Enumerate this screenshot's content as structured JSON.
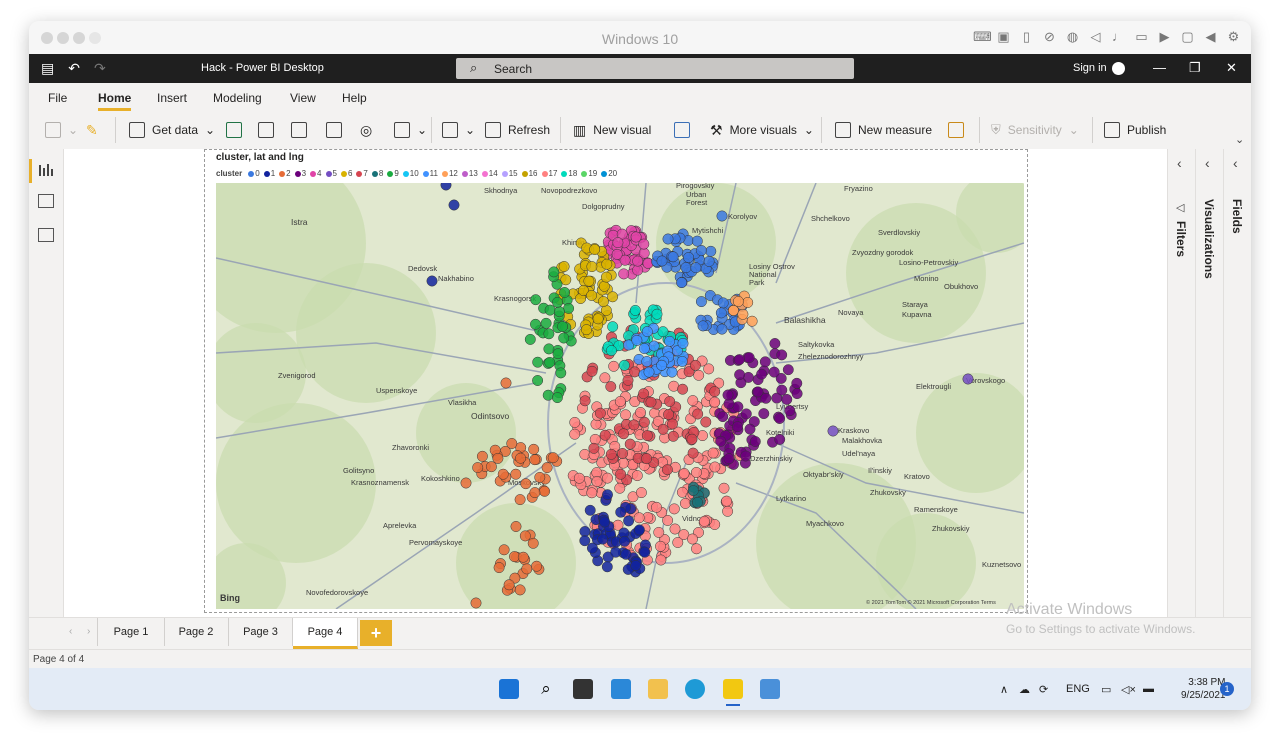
{
  "vm": {
    "title": "Windows 10"
  },
  "app": {
    "title": "Hack - Power BI Desktop",
    "search_placeholder": "Search",
    "sign_in": "Sign in"
  },
  "menu": [
    "File",
    "Home",
    "Insert",
    "Modeling",
    "View",
    "Help"
  ],
  "ribbon": {
    "get_data": "Get data",
    "refresh": "Refresh",
    "new_visual": "New visual",
    "more_visuals": "More visuals",
    "new_measure": "New measure",
    "sensitivity": "Sensitivity",
    "publish": "Publish"
  },
  "visual": {
    "title": "cluster, lat and lng",
    "legend_title": "cluster",
    "legend": [
      {
        "label": "0",
        "color": "#3b79e0"
      },
      {
        "label": "1",
        "color": "#12239e"
      },
      {
        "label": "2",
        "color": "#e66c37"
      },
      {
        "label": "3",
        "color": "#6b007b"
      },
      {
        "label": "4",
        "color": "#e044a7"
      },
      {
        "label": "5",
        "color": "#744ec2"
      },
      {
        "label": "6",
        "color": "#d9b300"
      },
      {
        "label": "7",
        "color": "#d64550"
      },
      {
        "label": "8",
        "color": "#197278"
      },
      {
        "label": "9",
        "color": "#1aab40"
      },
      {
        "label": "10",
        "color": "#15c6f4"
      },
      {
        "label": "11",
        "color": "#4092ff"
      },
      {
        "label": "12",
        "color": "#ffa058"
      },
      {
        "label": "13",
        "color": "#be5dc9"
      },
      {
        "label": "14",
        "color": "#f472d0"
      },
      {
        "label": "15",
        "color": "#b5a1ff"
      },
      {
        "label": "16",
        "color": "#c4a200"
      },
      {
        "label": "17",
        "color": "#ff8080"
      },
      {
        "label": "18",
        "color": "#00dbbc"
      },
      {
        "label": "19",
        "color": "#5bd667"
      },
      {
        "label": "20",
        "color": "#0091d5"
      }
    ],
    "map_places": [
      "Skhodnya",
      "Novopodrezkovo",
      "Dolgoprudny",
      "Pirogovskiy",
      "Urban",
      "Forest",
      "Fryazino",
      "Korolyov",
      "Mytishchi",
      "Shchelkovo",
      "Istra",
      "Khimki",
      "Sverdlovskiy",
      "Zvyozdny gorodok",
      "Losino-Petrovskiy",
      "Losiny Ostrov",
      "National",
      "Park",
      "Dedovsk",
      "Nakhabino",
      "Monino",
      "Obukhovo",
      "Krasnogorsk",
      "Staraya",
      "Kupavna",
      "Balashikha",
      "Novaya",
      "Saltykovka",
      "Zheleznodorozhnyy",
      "Zvenigorod",
      "Uspenskoye",
      "Elektrougli",
      "Vlasikha",
      "Odintsovo",
      "Lyubertsy",
      "Kotelniki",
      "Kraskovo",
      "Malakhovka",
      "Udel'naya",
      "Zhavoronki",
      "Dzerzhinskiy",
      "Golitsyno",
      "Krasnoznamensk",
      "Kokoshkino",
      "Moskovsky",
      "Il'inskiy",
      "Kratovo",
      "Oktyabr'skiy",
      "Zhukovsky",
      "Lytkarino",
      "Aprelevka",
      "Vidnoye",
      "Myachkovo",
      "Ramenskoye",
      "Pervomayskoye",
      "Zhukovskiy",
      "Kuznetsovo",
      "Novofedorovskoye",
      "Vorovskogo"
    ],
    "attribution": "© 2021 TomTom  © 2021 Microsoft Corporation  Terms",
    "bing": "Bing"
  },
  "panes": {
    "filters": "Filters",
    "visualizations": "Visualizations",
    "fields": "Fields"
  },
  "pages": [
    "Page 1",
    "Page 2",
    "Page 3",
    "Page 4"
  ],
  "active_page": "Page 4",
  "add_page": "+",
  "status": "Page 4 of 4",
  "watermark": {
    "line1": "Activate Windows",
    "line2": "Go to Settings to activate Windows."
  },
  "taskbar": {
    "language": "ENG",
    "time": "3:38 PM",
    "date": "9/25/2021",
    "notifications": "1"
  }
}
